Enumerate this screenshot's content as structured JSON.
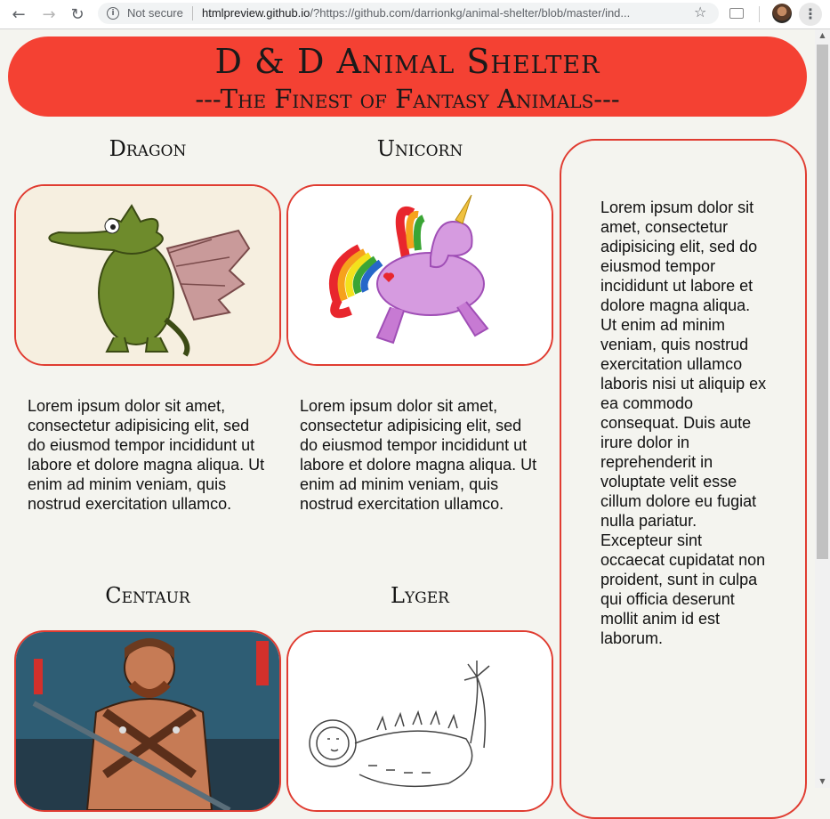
{
  "browser": {
    "security_label": "Not secure",
    "url_host": "htmlpreview.github.io",
    "url_path": "/?https://github.com/darrionkg/animal-shelter/blob/master/ind..."
  },
  "header": {
    "title": "D & D Animal Shelter",
    "subtitle": "---The Finest of Fantasy Animals---"
  },
  "animals": [
    {
      "name": "Dragon",
      "description": "Lorem ipsum dolor sit amet, consectetur adipisicing elit, sed do eiusmod tempor incididunt ut labore et dolore magna aliqua. Ut enim ad minim veniam, quis nostrud exercitation ullamco."
    },
    {
      "name": "Unicorn",
      "description": "Lorem ipsum dolor sit amet, consectetur adipisicing elit, sed do eiusmod tempor incididunt ut labore et dolore magna aliqua. Ut enim ad minim veniam, quis nostrud exercitation ullamco."
    },
    {
      "name": "Centaur"
    },
    {
      "name": "Lyger"
    }
  ],
  "sidebar": {
    "text": "Lorem ipsum dolor sit amet, consectetur adipisicing elit, sed do eiusmod tempor incididunt ut labore et dolore magna aliqua. Ut enim ad minim veniam, quis nostrud exercitation ullamco laboris nisi ut aliquip ex ea commodo consequat. Duis aute irure dolor in reprehenderit in voluptate velit esse cillum dolore eu fugiat nulla pariatur. Excepteur sint occaecat cupidatat non proident, sunt in culpa qui officia deserunt mollit anim id est laborum."
  },
  "colors": {
    "accent": "#f44133",
    "border": "#e03c31",
    "page_background": "#f4f4ef"
  }
}
